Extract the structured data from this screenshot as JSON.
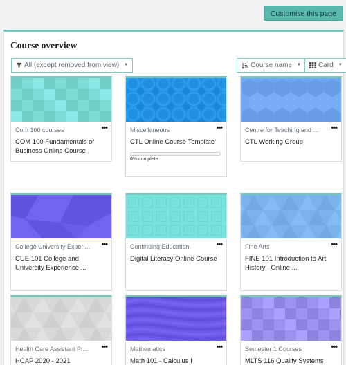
{
  "header": {
    "customise_label": "Customise this page"
  },
  "block": {
    "title": "Course overview",
    "filter": {
      "label": "All (except removed from view)",
      "icon": "filter-icon"
    },
    "sort": {
      "label": "Course name",
      "icon": "sort-amount-icon"
    },
    "view": {
      "label": "Card",
      "icon": "grid-icon"
    }
  },
  "menu_label": "•••",
  "courses": [
    {
      "category": "Com 100 courses",
      "name": "COM 100 Fundamentals of Business Online Course",
      "color": "#7ddcd6",
      "pattern": "squares"
    },
    {
      "category": "Miscellaneous",
      "name": "CTL Online Course Template",
      "color": "#1f8fe2",
      "pattern": "circles",
      "progress_percent": 0,
      "progress_value": "0",
      "progress_suffix": "% complete"
    },
    {
      "category": "Centre for Teaching and ...",
      "name": "CTL Working Group",
      "color": "#6fa6ef",
      "pattern": "hexagons"
    },
    {
      "category": "College University Experi...",
      "name": "CUE 101 College and University Experience ...",
      "color": "#6a5ee8",
      "pattern": "polygons"
    },
    {
      "category": "Continuing Education",
      "name": "Digital Literacy Online Course",
      "color": "#78e3dc",
      "pattern": "concentric-squares"
    },
    {
      "category": "Fine Arts",
      "name": "FINE 101 Introduction to Art History I Online ...",
      "color": "#7ab2ea",
      "pattern": "triangles"
    },
    {
      "category": "Health Care Assistant Pr...",
      "name": "HCAP 2020 - 2021",
      "color": "#d8d8d8",
      "pattern": "triangles-light"
    },
    {
      "category": "Mathematics",
      "name": "Math 101 - Calculus I",
      "color": "#6c5ae6",
      "pattern": "waves"
    },
    {
      "category": "Semester 1 Courses",
      "name": "MLTS 116 Quality Systems",
      "color": "#9c93ee",
      "pattern": "squares"
    }
  ]
}
